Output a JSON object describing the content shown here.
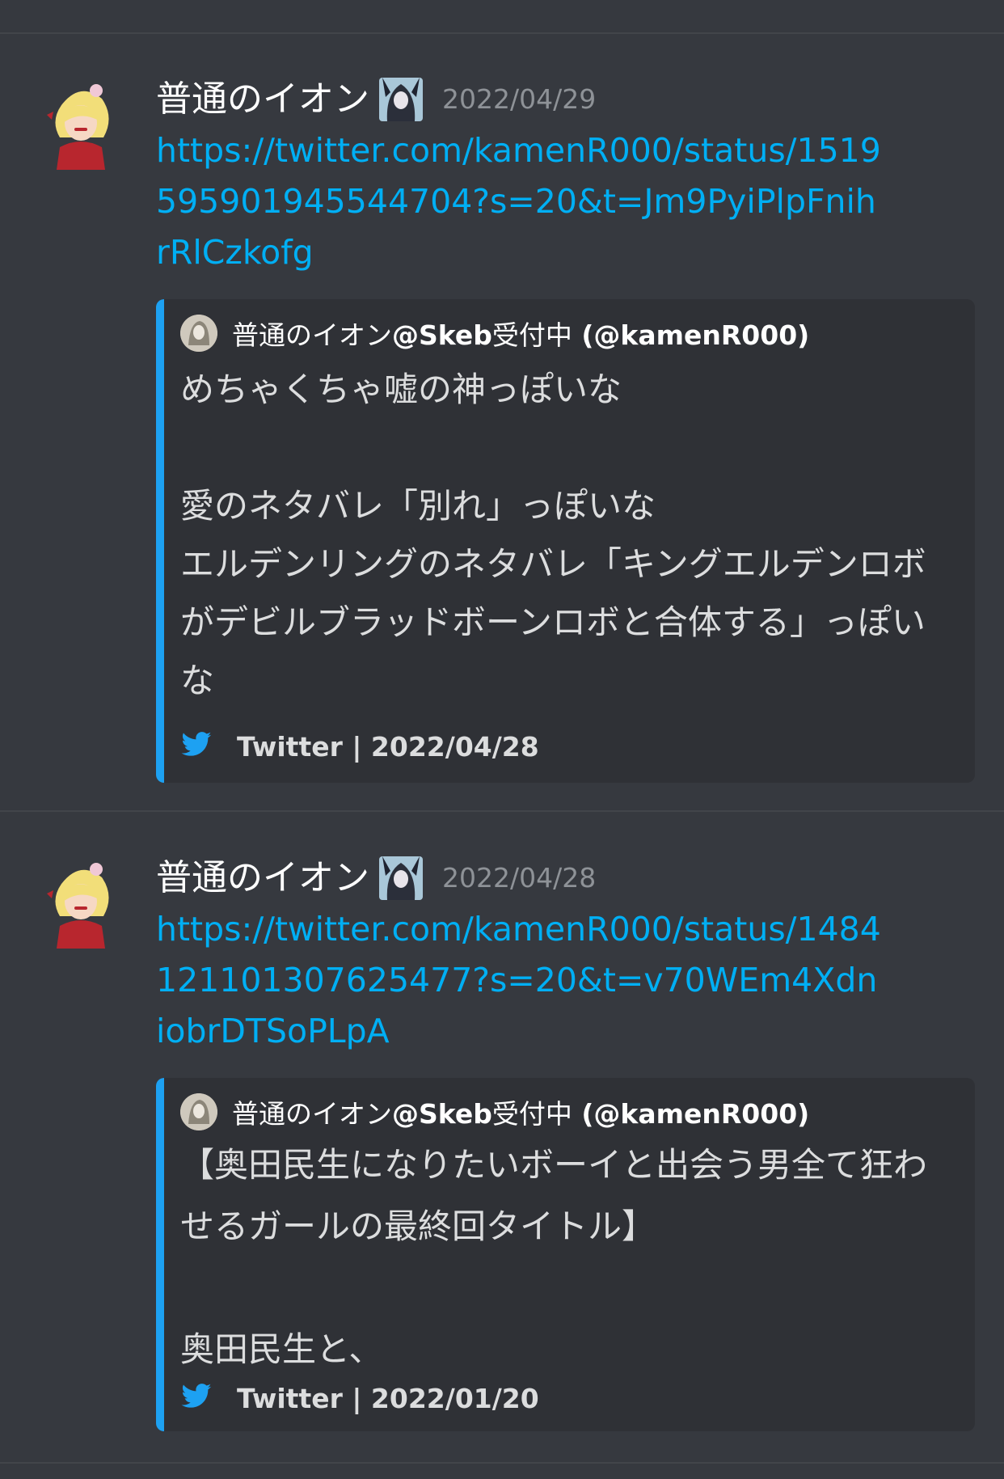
{
  "colors": {
    "background": "#36393f",
    "embed_background": "#2f3136",
    "embed_accent": "#1da1f2",
    "link": "#00aff4",
    "timestamp": "#8e9297"
  },
  "messages": [
    {
      "username": "普通のイオン",
      "timestamp": "2022/04/29",
      "link": "https://twitter.com/kamenR000/status/1519595901945544704?s=20&t=Jm9PyiPlpFnihrRlCzkofg",
      "embed": {
        "author_display": "普通のイオン",
        "author_handle_prefix": "@Skeb",
        "author_suffix": "受付中",
        "author_account": " (@kamenR000)",
        "description": "めちゃくちゃ嘘の神っぽいな\n\n愛のネタバレ「別れ」っぽいな\nエルデンリングのネタバレ「キングエルデンロボがデビルブラッドボーンロボと合体する」っぽいな",
        "footer": "Twitter | 2022/04/28",
        "footer_icon": "twitter-bird-icon"
      }
    },
    {
      "username": "普通のイオン",
      "timestamp": "2022/04/28",
      "link": "https://twitter.com/kamenR000/status/1484121101307625477?s=20&t=v70WEm4XdniobrDTSoPLpA",
      "embed": {
        "author_display": "普通のイオン",
        "author_handle_prefix": "@Skeb",
        "author_suffix": "受付中",
        "author_account": " (@kamenR000)",
        "description": "【奥田民生になりたいボーイと出会う男全て狂わせるガールの最終回タイトル】\n\n奥田民生と、",
        "footer": "Twitter | 2022/01/20",
        "footer_icon": "twitter-bird-icon"
      }
    }
  ]
}
